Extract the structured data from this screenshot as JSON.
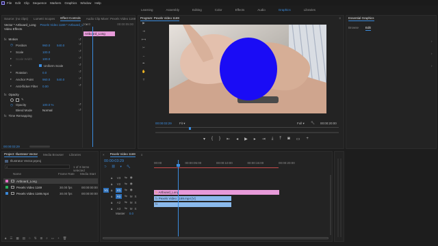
{
  "menu_bar": {
    "app_icon": "pr-logo-icon",
    "items": [
      "File",
      "Edit",
      "Clip",
      "Sequence",
      "Markers",
      "Graphics",
      "Window",
      "Help"
    ]
  },
  "workspaces": {
    "items": [
      "Learning",
      "Assembly",
      "Editing",
      "Color",
      "Effects",
      "Audio",
      "Graphics",
      "Libraries"
    ],
    "active": "Graphics"
  },
  "source_panel": {
    "tabs": [
      "Source: (no clips)",
      "Lumetri Scopes",
      "Effect Controls",
      "Audio Clip Mixer: Pexels Video 1169"
    ],
    "active_tab": "Effect Controls",
    "clip_selector": "Vector * Artboard_Long",
    "sequence_selector": "Pexels Video 1169 * Artboard_L",
    "section_label": "Video Effects",
    "ruler_time": "00:00",
    "ruler_end": "00:00:05:00",
    "mini_clip_label": "Artboard_Long",
    "motion": {
      "label": "Motion",
      "properties": [
        {
          "name": "Position",
          "value": "960.0",
          "value2": "540.0"
        },
        {
          "name": "Scale",
          "value": "100.0"
        },
        {
          "name": "Scale Width",
          "value": "100.0"
        },
        {
          "name": "Uniform Scale",
          "value": ""
        },
        {
          "name": "Rotation",
          "value": "0.0"
        },
        {
          "name": "Anchor Point",
          "value": "960.0",
          "value2": "540.0"
        },
        {
          "name": "Anti-flicker Filter",
          "value": "0.00"
        }
      ]
    },
    "opacity": {
      "label": "Opacity",
      "properties": [
        {
          "name": "Opacity",
          "value": "100.0 %"
        },
        {
          "name": "Blend Mode",
          "value": "Normal"
        }
      ]
    },
    "time_remap": "Time Remapping",
    "bottom_time": "00:00:03:29"
  },
  "program_monitor": {
    "title": "Program: Pexels Video 1169",
    "current_time": "00:00:03:29",
    "fit": "Fit",
    "quality": "Full",
    "duration": "00:00:20:00",
    "overlay_shape_color": "#1a0cf5"
  },
  "essential_graphics": {
    "title": "Essential Graphics",
    "tabs": [
      "Browse",
      "Edit"
    ],
    "active_tab": "Edit"
  },
  "project_panel": {
    "tabs": [
      "Project: Illustrator Vector",
      "Media Browser",
      "Libraries"
    ],
    "active_tab": "Project: Illustrator Vector",
    "project_file": "Illustrator Vector.prproj",
    "selection_info": "1 of 3 items selected",
    "columns": [
      "Name",
      "Frame Rate",
      "Media Start"
    ],
    "items": [
      {
        "color": "#e673c8",
        "name": "Artboard_Long",
        "frame_rate": "",
        "media_start": ""
      },
      {
        "color": "#27b05a",
        "name": "Pexels Video 1169",
        "frame_rate": "30.00 fps",
        "media_start": "00:00:00:00"
      },
      {
        "color": "#3a87d6",
        "name": "Pexels Video 1169.mp4",
        "frame_rate": "30.00 fps",
        "media_start": "00:00:00:00"
      }
    ]
  },
  "timeline": {
    "tab": "Pexels Video 1169",
    "timecode": "00:00:03:29",
    "ruler_labels": [
      "00:00",
      "00:00:05:00",
      "00:00:10:00",
      "00:00:15:00",
      "00:00:20:00"
    ],
    "tracks": [
      "V3",
      "V2",
      "V1",
      "A1",
      "A2",
      "A3"
    ],
    "source_patch": "V1",
    "master": "Master",
    "master_value": "0.0",
    "clips": {
      "v2": "Artboard_Long",
      "v1": "Pexels Video 1169.mp4 [V]",
      "a1": ""
    }
  }
}
